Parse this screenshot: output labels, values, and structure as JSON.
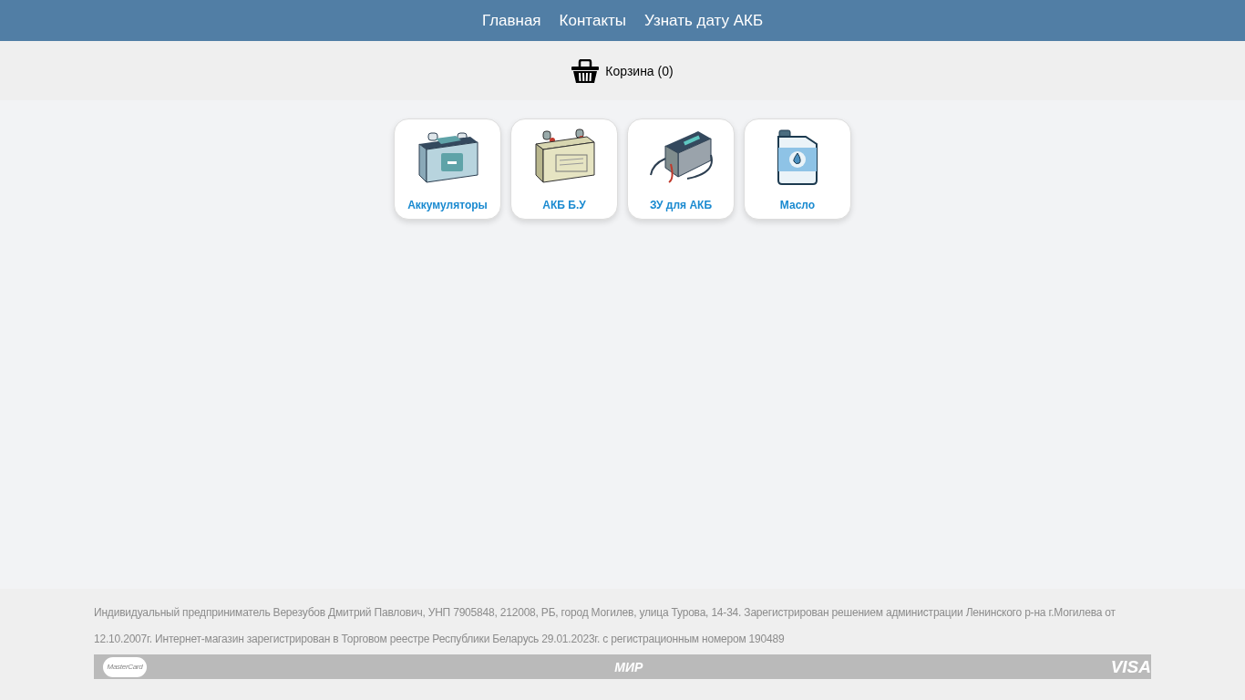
{
  "nav": {
    "links": [
      "Главная",
      "Контакты",
      "Узнать дату АКБ"
    ]
  },
  "cart": {
    "label": "Корзина (0)"
  },
  "categories": [
    {
      "label": "Аккумуляторы",
      "kind": "battery"
    },
    {
      "label": "АКБ Б.У",
      "kind": "used-battery"
    },
    {
      "label": "ЗУ для АКБ",
      "kind": "charger"
    },
    {
      "label": "Масло",
      "kind": "canister"
    }
  ],
  "footer": {
    "text": "Индивидуальный предприниматель Верезубов Дмитрий Павлович, УНП 7905848, 212008, РБ, город Могилев, улица Турова, 14-34. Зарегистрирован решением администрации Ленинского  р-на г.Могилева от 12.10.2007г. Интернет-магазин зарегистрирован в Торговом реестре Республики Беларусь 29.01.2023г. с регистрационным номером 190489",
    "payments": [
      {
        "label": "MasterCard",
        "kind": "mastercard"
      },
      {
        "label": "МИР",
        "kind": "mir"
      },
      {
        "label": "VISA",
        "kind": "visa"
      }
    ]
  }
}
